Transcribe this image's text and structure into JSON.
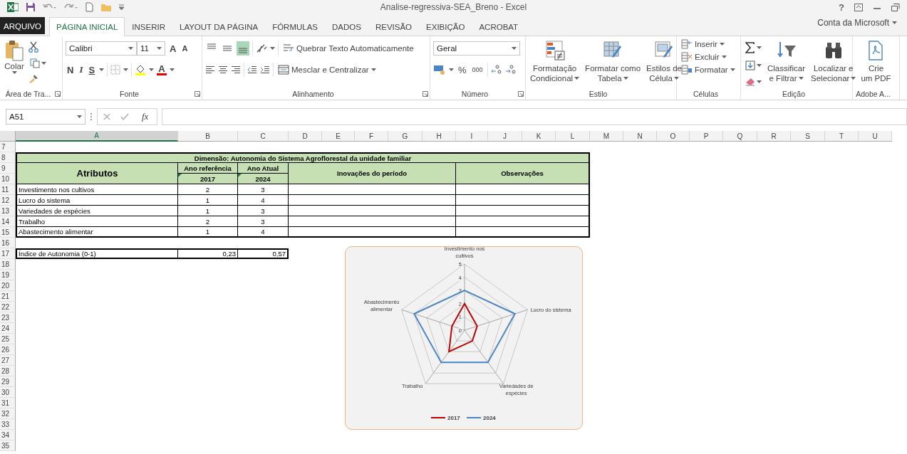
{
  "window": {
    "title": "Analise-regressiva-SEA_Breno - Excel",
    "help": "?"
  },
  "tabs": [
    {
      "label": "ARQUIVO",
      "kind": "file",
      "selected": false
    },
    {
      "label": "PÁGINA INICIAL",
      "kind": "tab",
      "selected": true
    },
    {
      "label": "INSERIR",
      "kind": "tab",
      "selected": false
    },
    {
      "label": "LAYOUT DA PÁGINA",
      "kind": "tab",
      "selected": false
    },
    {
      "label": "FÓRMULAS",
      "kind": "tab",
      "selected": false
    },
    {
      "label": "DADOS",
      "kind": "tab",
      "selected": false
    },
    {
      "label": "REVISÃO",
      "kind": "tab",
      "selected": false
    },
    {
      "label": "EXIBIÇÃO",
      "kind": "tab",
      "selected": false
    },
    {
      "label": "ACROBAT",
      "kind": "tab",
      "selected": false
    }
  ],
  "account": "Conta da Microsoft",
  "ribbon": {
    "clipboard": {
      "label": "Área de Tra...",
      "paste": "Colar"
    },
    "font": {
      "label": "Fonte",
      "font_name": "Calibri",
      "font_size": "11",
      "grow": "A",
      "shrink": "A",
      "bold": "N",
      "italic": "I",
      "underline": "S",
      "font_color": "A"
    },
    "alignment": {
      "label": "Alinhamento",
      "vertical_align": [
        {
          "selected": false
        },
        {
          "selected": false
        },
        {
          "selected": true
        }
      ],
      "wrap_text": "Quebrar Texto Automaticamente",
      "merge": "Mesclar e Centralizar"
    },
    "number": {
      "label": "Número",
      "format": "Geral",
      "percent": "%",
      "thousands": "000"
    },
    "styles": {
      "label": "Estilo",
      "buttons": [
        [
          "Formatação",
          "Condicional"
        ],
        [
          "Formatar como",
          "Tabela"
        ],
        [
          "Estilos de",
          "Célula"
        ]
      ]
    },
    "cells": {
      "label": "Células",
      "buttons": [
        "Inserir",
        "Excluir",
        "Formatar"
      ]
    },
    "editing": {
      "label": "Edição",
      "buttons": [
        [
          "Classificar",
          "e Filtrar"
        ],
        [
          "Localizar e",
          "Selecionar"
        ]
      ]
    },
    "adobe": {
      "label": "Adobe A...",
      "button": [
        "Crie",
        "um PDF"
      ]
    }
  },
  "formula_bar": {
    "name_box": "A51",
    "function_button": "fx"
  },
  "sheet": {
    "columns": [
      {
        "label": "A",
        "selected": true
      },
      {
        "label": "B",
        "selected": false
      },
      {
        "label": "C",
        "selected": false
      },
      {
        "label": "D",
        "selected": false
      },
      {
        "label": "E",
        "selected": false
      },
      {
        "label": "F",
        "selected": false
      },
      {
        "label": "G",
        "selected": false
      },
      {
        "label": "H",
        "selected": false
      },
      {
        "label": "I",
        "selected": false
      },
      {
        "label": "J",
        "selected": false
      },
      {
        "label": "K",
        "selected": false
      },
      {
        "label": "L",
        "selected": false
      },
      {
        "label": "M",
        "selected": false
      },
      {
        "label": "N",
        "selected": false
      },
      {
        "label": "O",
        "selected": false
      },
      {
        "label": "P",
        "selected": false
      },
      {
        "label": "Q",
        "selected": false
      },
      {
        "label": "R",
        "selected": false
      },
      {
        "label": "S",
        "selected": false
      },
      {
        "label": "T",
        "selected": false
      },
      {
        "label": "U",
        "selected": false
      }
    ],
    "rows": [
      "7",
      "8",
      "9",
      "10",
      "11",
      "12",
      "13",
      "14",
      "15",
      "16",
      "17",
      "18",
      "19",
      "20",
      "21",
      "22",
      "23",
      "24",
      "25",
      "26",
      "27",
      "28",
      "29",
      "30",
      "31",
      "32",
      "33",
      "34",
      "35"
    ],
    "table": {
      "title": "Dimensão: Autonomia do Sistema Agroflorestal da unidade familiar",
      "attributes_header": "Atributos",
      "reference_header": "Ano referência",
      "reference_year": "2017",
      "current_header": "Ano Atual",
      "current_year": "2024",
      "innovations_header": "Inovações do período",
      "observations_header": "Observações",
      "rows": [
        {
          "attribute": "Investimento nos cultivos",
          "reference": "2",
          "current": "3"
        },
        {
          "attribute": "Lucro do sistema",
          "reference": "1",
          "current": "4"
        },
        {
          "attribute": "Variedades de espécies",
          "reference": "1",
          "current": "3"
        },
        {
          "attribute": "Trabalho",
          "reference": "2",
          "current": "3"
        },
        {
          "attribute": "Abastecimento alimentar",
          "reference": "1",
          "current": "4"
        }
      ]
    },
    "index": {
      "label": "Índice de Autonomia (0-1)",
      "reference": "0,23",
      "current": "0,57"
    },
    "chart": {
      "chart_data": {
        "type": "radar",
        "categories": [
          "Investimento nos cultivos",
          "Lucro do sistema",
          "Variedades de espécies",
          "Trabalho",
          "Abastecimento alimentar"
        ],
        "series": [
          {
            "name": "2017",
            "color": "#c00000",
            "values": [
              2,
              1,
              1,
              2,
              1
            ]
          },
          {
            "name": "2024",
            "color": "#4a86c5",
            "values": [
              3,
              4,
              3,
              3,
              4
            ]
          }
        ],
        "ylim": [
          0,
          5
        ],
        "yticks": [
          0,
          1,
          2,
          3,
          4,
          5
        ],
        "legend": "bottom"
      }
    }
  }
}
